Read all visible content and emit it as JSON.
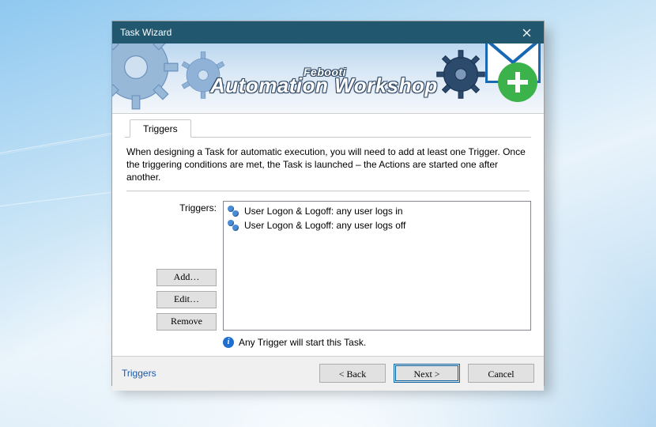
{
  "window": {
    "title": "Task Wizard"
  },
  "banner": {
    "line1": "Febooti",
    "line2": "Automation Workshop"
  },
  "tab": {
    "label": "Triggers"
  },
  "description": "When designing a Task for automatic execution, you will need to add at least one Trigger. Once the triggering conditions are met, the Task is launched – the Actions are started one after another.",
  "triggers": {
    "label": "Triggers:",
    "items": [
      "User Logon & Logoff: any user logs in",
      "User Logon & Logoff: any user logs off"
    ]
  },
  "buttons": {
    "add": "Add…",
    "edit": "Edit…",
    "remove": "Remove",
    "back": "< Back",
    "next": "Next >",
    "cancel": "Cancel"
  },
  "info": "Any Trigger will start this Task.",
  "help_link": "Triggers"
}
